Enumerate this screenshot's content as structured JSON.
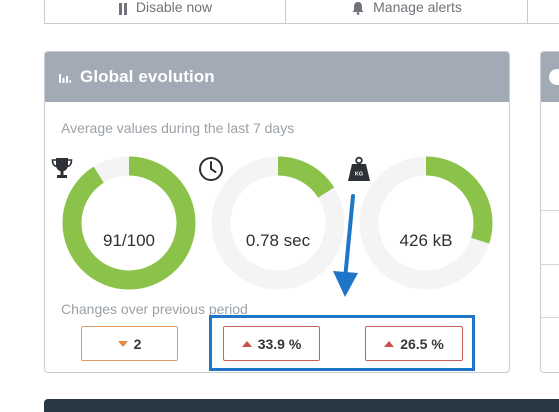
{
  "toolbar": {
    "disable_label": "Disable now",
    "disable_icon": "pause-icon",
    "alerts_label": "Manage alerts",
    "alerts_icon": "bell-icon"
  },
  "card": {
    "title": "Global evolution",
    "title_icon": "bar-chart-icon",
    "subtitle": "Average values during the last 7 days",
    "changes_label": "Changes over previous period"
  },
  "gauges": [
    {
      "icon": "trophy-icon",
      "value": "91/100",
      "fill_fraction": 0.91
    },
    {
      "icon": "clock-icon",
      "value": "0.78 sec",
      "fill_fraction": 0.16
    },
    {
      "icon": "weight-icon",
      "value": "426 kB",
      "fill_fraction": 0.3,
      "icon_text": "KG"
    }
  ],
  "changes": [
    {
      "value": "2",
      "direction": "down"
    },
    {
      "value": "33.9 %",
      "direction": "up"
    },
    {
      "value": "26.5 %",
      "direction": "up"
    }
  ],
  "colors": {
    "gauge_fill": "#8bc34a",
    "gauge_track": "#f4f4f4",
    "header": "#a2abb5",
    "highlight": "#1f76c9",
    "down_accent": "#e38a45",
    "up_accent": "#c2524a"
  }
}
